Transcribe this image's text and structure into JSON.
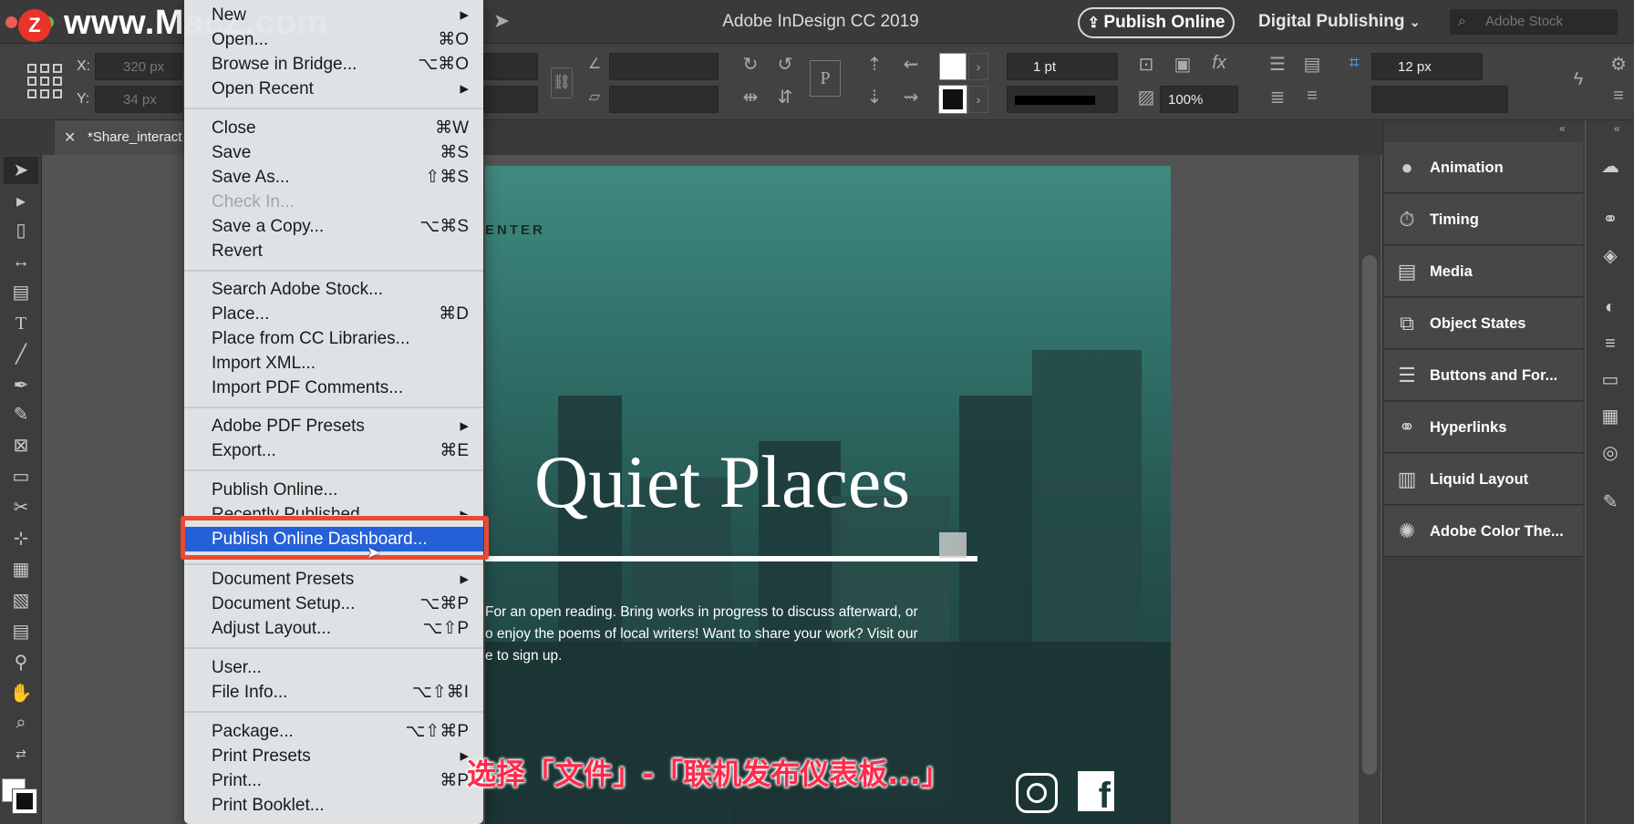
{
  "app": {
    "title": "Adobe InDesign CC 2019",
    "publish_label": "Publish Online",
    "workspace_label": "Digital Publishing",
    "stock_placeholder": "Adobe Stock"
  },
  "watermark": {
    "logo": "Z",
    "text": "www.MacZ.com"
  },
  "control_bar": {
    "x_label": "X:",
    "x_value": "320 px",
    "y_label": "Y:",
    "y_value": "34 px",
    "stroke_weight": "1 pt",
    "opacity": "100%",
    "spacing": "12 px",
    "stroke_color": "#000000",
    "fill_color": "#ffffff"
  },
  "document": {
    "tab_label": "*Share_interact",
    "header_fragment": "ENTER",
    "heading": "Quiet Places",
    "body_lines": [
      "For an open reading. Bring works in progress to discuss afterward, or",
      "o enjoy the poems of local writers! Want to share your work? Visit our",
      "e to sign up."
    ],
    "social": {
      "instagram": "instagram-icon",
      "facebook": "f"
    }
  },
  "menu": {
    "items": [
      {
        "label": "New",
        "shortcut": "▸"
      },
      {
        "label": "Open...",
        "shortcut": "⌘O"
      },
      {
        "label": "Browse in Bridge...",
        "shortcut": "⌥⌘O"
      },
      {
        "label": "Open Recent",
        "shortcut": "▸"
      },
      {
        "label": "Close",
        "shortcut": "⌘W"
      },
      {
        "label": "Save",
        "shortcut": "⌘S"
      },
      {
        "label": "Save As...",
        "shortcut": "⇧⌘S"
      },
      {
        "label": "Check In...",
        "shortcut": ""
      },
      {
        "label": "Save a Copy...",
        "shortcut": "⌥⌘S"
      },
      {
        "label": "Revert",
        "shortcut": ""
      },
      {
        "label": "Search Adobe Stock...",
        "shortcut": ""
      },
      {
        "label": "Place...",
        "shortcut": "⌘D"
      },
      {
        "label": "Place from CC Libraries...",
        "shortcut": ""
      },
      {
        "label": "Import XML...",
        "shortcut": ""
      },
      {
        "label": "Import PDF Comments...",
        "shortcut": ""
      },
      {
        "label": "Adobe PDF Presets",
        "shortcut": "▸"
      },
      {
        "label": "Export...",
        "shortcut": "⌘E"
      },
      {
        "label": "Publish Online...",
        "shortcut": ""
      },
      {
        "label": "Recently Published",
        "shortcut": "▸"
      },
      {
        "label": "Publish Online Dashboard...",
        "shortcut": ""
      },
      {
        "label": "Document Presets",
        "shortcut": "▸"
      },
      {
        "label": "Document Setup...",
        "shortcut": "⌥⌘P"
      },
      {
        "label": "Adjust Layout...",
        "shortcut": "⌥⇧P"
      },
      {
        "label": "User...",
        "shortcut": ""
      },
      {
        "label": "File Info...",
        "shortcut": "⌥⇧⌘I"
      },
      {
        "label": "Package...",
        "shortcut": "⌥⇧⌘P"
      },
      {
        "label": "Print Presets",
        "shortcut": "▸"
      },
      {
        "label": "Print...",
        "shortcut": "⌘P"
      },
      {
        "label": "Print Booklet...",
        "shortcut": ""
      }
    ],
    "selected": "Publish Online Dashboard...",
    "disabled": "Check In..."
  },
  "panels": [
    {
      "label": "Animation",
      "icon": "animation-icon"
    },
    {
      "label": "Timing",
      "icon": "timing-icon"
    },
    {
      "label": "Media",
      "icon": "media-icon"
    },
    {
      "label": "Object States",
      "icon": "object-states-icon"
    },
    {
      "label": "Buttons and For...",
      "icon": "buttons-forms-icon"
    },
    {
      "label": "Hyperlinks",
      "icon": "hyperlinks-icon"
    },
    {
      "label": "Liquid Layout",
      "icon": "liquid-layout-icon"
    },
    {
      "label": "Adobe Color The...",
      "icon": "adobe-color-themes-icon"
    }
  ],
  "caption": "选择「文件」-「联机发布仪表板...」",
  "colors": {
    "menu_highlight": "#2660d9",
    "callout_border": "#e84a34",
    "caption_text": "#ff2a4a"
  }
}
